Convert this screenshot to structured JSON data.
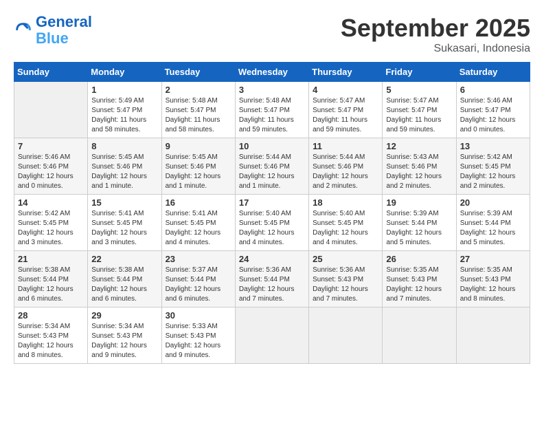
{
  "logo": {
    "line1": "General",
    "line2": "Blue"
  },
  "title": "September 2025",
  "subtitle": "Sukasari, Indonesia",
  "days": [
    "Sunday",
    "Monday",
    "Tuesday",
    "Wednesday",
    "Thursday",
    "Friday",
    "Saturday"
  ],
  "weeks": [
    [
      {
        "num": "",
        "sunrise": "",
        "sunset": "",
        "daylight": ""
      },
      {
        "num": "1",
        "sunrise": "Sunrise: 5:49 AM",
        "sunset": "Sunset: 5:47 PM",
        "daylight": "Daylight: 11 hours and 58 minutes."
      },
      {
        "num": "2",
        "sunrise": "Sunrise: 5:48 AM",
        "sunset": "Sunset: 5:47 PM",
        "daylight": "Daylight: 11 hours and 58 minutes."
      },
      {
        "num": "3",
        "sunrise": "Sunrise: 5:48 AM",
        "sunset": "Sunset: 5:47 PM",
        "daylight": "Daylight: 11 hours and 59 minutes."
      },
      {
        "num": "4",
        "sunrise": "Sunrise: 5:47 AM",
        "sunset": "Sunset: 5:47 PM",
        "daylight": "Daylight: 11 hours and 59 minutes."
      },
      {
        "num": "5",
        "sunrise": "Sunrise: 5:47 AM",
        "sunset": "Sunset: 5:47 PM",
        "daylight": "Daylight: 11 hours and 59 minutes."
      },
      {
        "num": "6",
        "sunrise": "Sunrise: 5:46 AM",
        "sunset": "Sunset: 5:47 PM",
        "daylight": "Daylight: 12 hours and 0 minutes."
      }
    ],
    [
      {
        "num": "7",
        "sunrise": "Sunrise: 5:46 AM",
        "sunset": "Sunset: 5:46 PM",
        "daylight": "Daylight: 12 hours and 0 minutes."
      },
      {
        "num": "8",
        "sunrise": "Sunrise: 5:45 AM",
        "sunset": "Sunset: 5:46 PM",
        "daylight": "Daylight: 12 hours and 1 minute."
      },
      {
        "num": "9",
        "sunrise": "Sunrise: 5:45 AM",
        "sunset": "Sunset: 5:46 PM",
        "daylight": "Daylight: 12 hours and 1 minute."
      },
      {
        "num": "10",
        "sunrise": "Sunrise: 5:44 AM",
        "sunset": "Sunset: 5:46 PM",
        "daylight": "Daylight: 12 hours and 1 minute."
      },
      {
        "num": "11",
        "sunrise": "Sunrise: 5:44 AM",
        "sunset": "Sunset: 5:46 PM",
        "daylight": "Daylight: 12 hours and 2 minutes."
      },
      {
        "num": "12",
        "sunrise": "Sunrise: 5:43 AM",
        "sunset": "Sunset: 5:46 PM",
        "daylight": "Daylight: 12 hours and 2 minutes."
      },
      {
        "num": "13",
        "sunrise": "Sunrise: 5:42 AM",
        "sunset": "Sunset: 5:45 PM",
        "daylight": "Daylight: 12 hours and 2 minutes."
      }
    ],
    [
      {
        "num": "14",
        "sunrise": "Sunrise: 5:42 AM",
        "sunset": "Sunset: 5:45 PM",
        "daylight": "Daylight: 12 hours and 3 minutes."
      },
      {
        "num": "15",
        "sunrise": "Sunrise: 5:41 AM",
        "sunset": "Sunset: 5:45 PM",
        "daylight": "Daylight: 12 hours and 3 minutes."
      },
      {
        "num": "16",
        "sunrise": "Sunrise: 5:41 AM",
        "sunset": "Sunset: 5:45 PM",
        "daylight": "Daylight: 12 hours and 4 minutes."
      },
      {
        "num": "17",
        "sunrise": "Sunrise: 5:40 AM",
        "sunset": "Sunset: 5:45 PM",
        "daylight": "Daylight: 12 hours and 4 minutes."
      },
      {
        "num": "18",
        "sunrise": "Sunrise: 5:40 AM",
        "sunset": "Sunset: 5:45 PM",
        "daylight": "Daylight: 12 hours and 4 minutes."
      },
      {
        "num": "19",
        "sunrise": "Sunrise: 5:39 AM",
        "sunset": "Sunset: 5:44 PM",
        "daylight": "Daylight: 12 hours and 5 minutes."
      },
      {
        "num": "20",
        "sunrise": "Sunrise: 5:39 AM",
        "sunset": "Sunset: 5:44 PM",
        "daylight": "Daylight: 12 hours and 5 minutes."
      }
    ],
    [
      {
        "num": "21",
        "sunrise": "Sunrise: 5:38 AM",
        "sunset": "Sunset: 5:44 PM",
        "daylight": "Daylight: 12 hours and 6 minutes."
      },
      {
        "num": "22",
        "sunrise": "Sunrise: 5:38 AM",
        "sunset": "Sunset: 5:44 PM",
        "daylight": "Daylight: 12 hours and 6 minutes."
      },
      {
        "num": "23",
        "sunrise": "Sunrise: 5:37 AM",
        "sunset": "Sunset: 5:44 PM",
        "daylight": "Daylight: 12 hours and 6 minutes."
      },
      {
        "num": "24",
        "sunrise": "Sunrise: 5:36 AM",
        "sunset": "Sunset: 5:44 PM",
        "daylight": "Daylight: 12 hours and 7 minutes."
      },
      {
        "num": "25",
        "sunrise": "Sunrise: 5:36 AM",
        "sunset": "Sunset: 5:43 PM",
        "daylight": "Daylight: 12 hours and 7 minutes."
      },
      {
        "num": "26",
        "sunrise": "Sunrise: 5:35 AM",
        "sunset": "Sunset: 5:43 PM",
        "daylight": "Daylight: 12 hours and 7 minutes."
      },
      {
        "num": "27",
        "sunrise": "Sunrise: 5:35 AM",
        "sunset": "Sunset: 5:43 PM",
        "daylight": "Daylight: 12 hours and 8 minutes."
      }
    ],
    [
      {
        "num": "28",
        "sunrise": "Sunrise: 5:34 AM",
        "sunset": "Sunset: 5:43 PM",
        "daylight": "Daylight: 12 hours and 8 minutes."
      },
      {
        "num": "29",
        "sunrise": "Sunrise: 5:34 AM",
        "sunset": "Sunset: 5:43 PM",
        "daylight": "Daylight: 12 hours and 9 minutes."
      },
      {
        "num": "30",
        "sunrise": "Sunrise: 5:33 AM",
        "sunset": "Sunset: 5:43 PM",
        "daylight": "Daylight: 12 hours and 9 minutes."
      },
      {
        "num": "",
        "sunrise": "",
        "sunset": "",
        "daylight": ""
      },
      {
        "num": "",
        "sunrise": "",
        "sunset": "",
        "daylight": ""
      },
      {
        "num": "",
        "sunrise": "",
        "sunset": "",
        "daylight": ""
      },
      {
        "num": "",
        "sunrise": "",
        "sunset": "",
        "daylight": ""
      }
    ]
  ]
}
